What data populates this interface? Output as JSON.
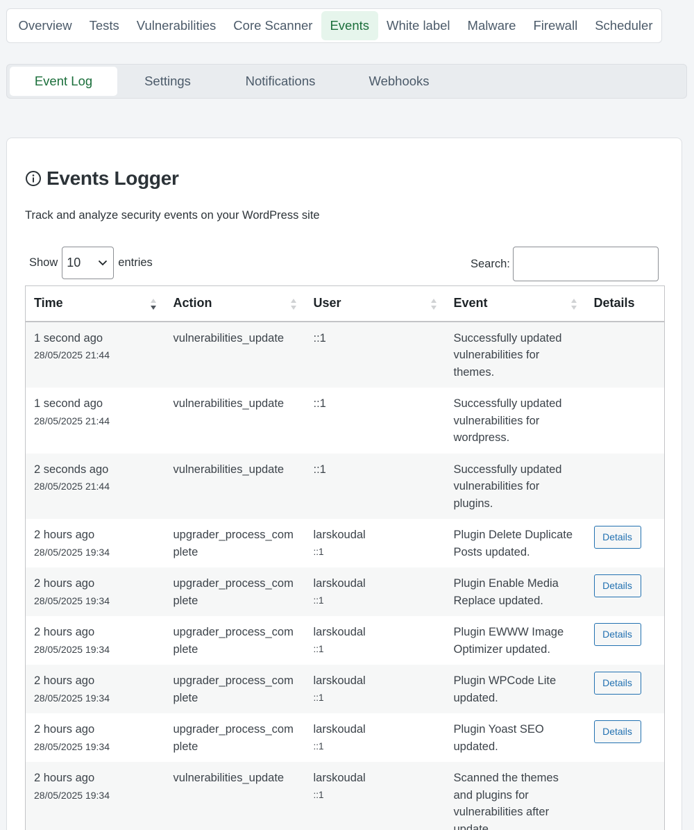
{
  "top_nav": {
    "tabs": [
      {
        "label": "Overview"
      },
      {
        "label": "Tests"
      },
      {
        "label": "Vulnerabilities"
      },
      {
        "label": "Core Scanner"
      },
      {
        "label": "Events"
      },
      {
        "label": "White label"
      },
      {
        "label": "Malware"
      },
      {
        "label": "Firewall"
      },
      {
        "label": "Scheduler"
      }
    ],
    "active": "Events"
  },
  "sub_nav": {
    "tabs": [
      {
        "label": "Event Log"
      },
      {
        "label": "Settings"
      },
      {
        "label": "Notifications"
      },
      {
        "label": "Webhooks"
      }
    ],
    "active": "Event Log"
  },
  "card": {
    "title": "Events Logger",
    "icon": "info-circle-icon",
    "description": "Track and analyze security events on your WordPress site"
  },
  "length_control": {
    "show_label": "Show",
    "selected": "10",
    "entries_label": "entries"
  },
  "search": {
    "label": "Search:",
    "value": ""
  },
  "table": {
    "columns": [
      {
        "label": "Time"
      },
      {
        "label": "Action"
      },
      {
        "label": "User"
      },
      {
        "label": "Event"
      },
      {
        "label": "Details"
      }
    ],
    "rows": [
      {
        "time": "1 second ago",
        "timestamp": "28/05/2025 21:44",
        "action": "vulnerabilities_update",
        "user": "::1",
        "ip": "",
        "event": "Successfully updated vulnerabilities for themes.",
        "details": ""
      },
      {
        "time": "1 second ago",
        "timestamp": "28/05/2025 21:44",
        "action": "vulnerabilities_update",
        "user": "::1",
        "ip": "",
        "event": "Successfully updated vulnerabilities for wordpress.",
        "details": ""
      },
      {
        "time": "2 seconds ago",
        "timestamp": "28/05/2025 21:44",
        "action": "vulnerabilities_update",
        "user": "::1",
        "ip": "",
        "event": "Successfully updated vulnerabilities for plugins.",
        "details": ""
      },
      {
        "time": "2 hours ago",
        "timestamp": "28/05/2025 19:34",
        "action": "upgrader_process_complete",
        "user": "larskoudal",
        "ip": "::1",
        "event": "Plugin Delete Duplicate Posts updated.",
        "details": "Details"
      },
      {
        "time": "2 hours ago",
        "timestamp": "28/05/2025 19:34",
        "action": "upgrader_process_complete",
        "user": "larskoudal",
        "ip": "::1",
        "event": "Plugin Enable Media Replace updated.",
        "details": "Details"
      },
      {
        "time": "2 hours ago",
        "timestamp": "28/05/2025 19:34",
        "action": "upgrader_process_complete",
        "user": "larskoudal",
        "ip": "::1",
        "event": "Plugin EWWW Image Optimizer updated.",
        "details": "Details"
      },
      {
        "time": "2 hours ago",
        "timestamp": "28/05/2025 19:34",
        "action": "upgrader_process_complete",
        "user": "larskoudal",
        "ip": "::1",
        "event": "Plugin WPCode Lite updated.",
        "details": "Details"
      },
      {
        "time": "2 hours ago",
        "timestamp": "28/05/2025 19:34",
        "action": "upgrader_process_complete",
        "user": "larskoudal",
        "ip": "::1",
        "event": "Plugin Yoast SEO updated.",
        "details": "Details"
      },
      {
        "time": "2 hours ago",
        "timestamp": "28/05/2025 19:34",
        "action": "vulnerabilities_update",
        "user": "larskoudal",
        "ip": "::1",
        "event": "Scanned the themes and plugins for vulnerabilities after update.",
        "details": ""
      }
    ]
  },
  "colors": {
    "accent_green": "#1a6e3a",
    "active_tab_bg": "#e6f5ec",
    "button_blue": "#2271b1"
  }
}
